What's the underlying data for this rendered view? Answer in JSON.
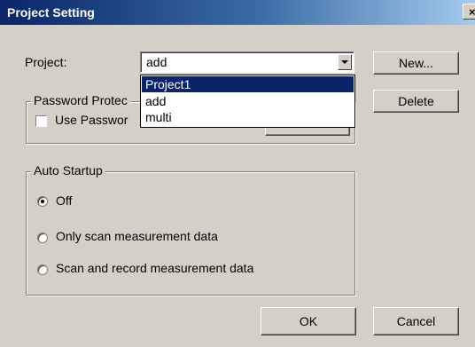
{
  "window": {
    "title": "Project Setting",
    "close_glyph": "×"
  },
  "project": {
    "label": "Project:",
    "selected": "add",
    "options": [
      "Project1",
      "add",
      "multi"
    ],
    "highlighted": "Project1"
  },
  "buttons": {
    "new": "New...",
    "delete": "Delete",
    "ok": "OK",
    "cancel": "Cancel"
  },
  "password_group": {
    "legend": "Password Protec",
    "checkbox_label": "Use Passwor",
    "checked": false
  },
  "auto_startup": {
    "legend": "Auto Startup",
    "options": [
      "Off",
      "Only scan measurement data",
      "Scan and record measurement data"
    ],
    "selected": "Off"
  },
  "colors": {
    "titlebar": "#0a246a",
    "face": "#d4d0c8",
    "highlight": "#0a246a"
  }
}
